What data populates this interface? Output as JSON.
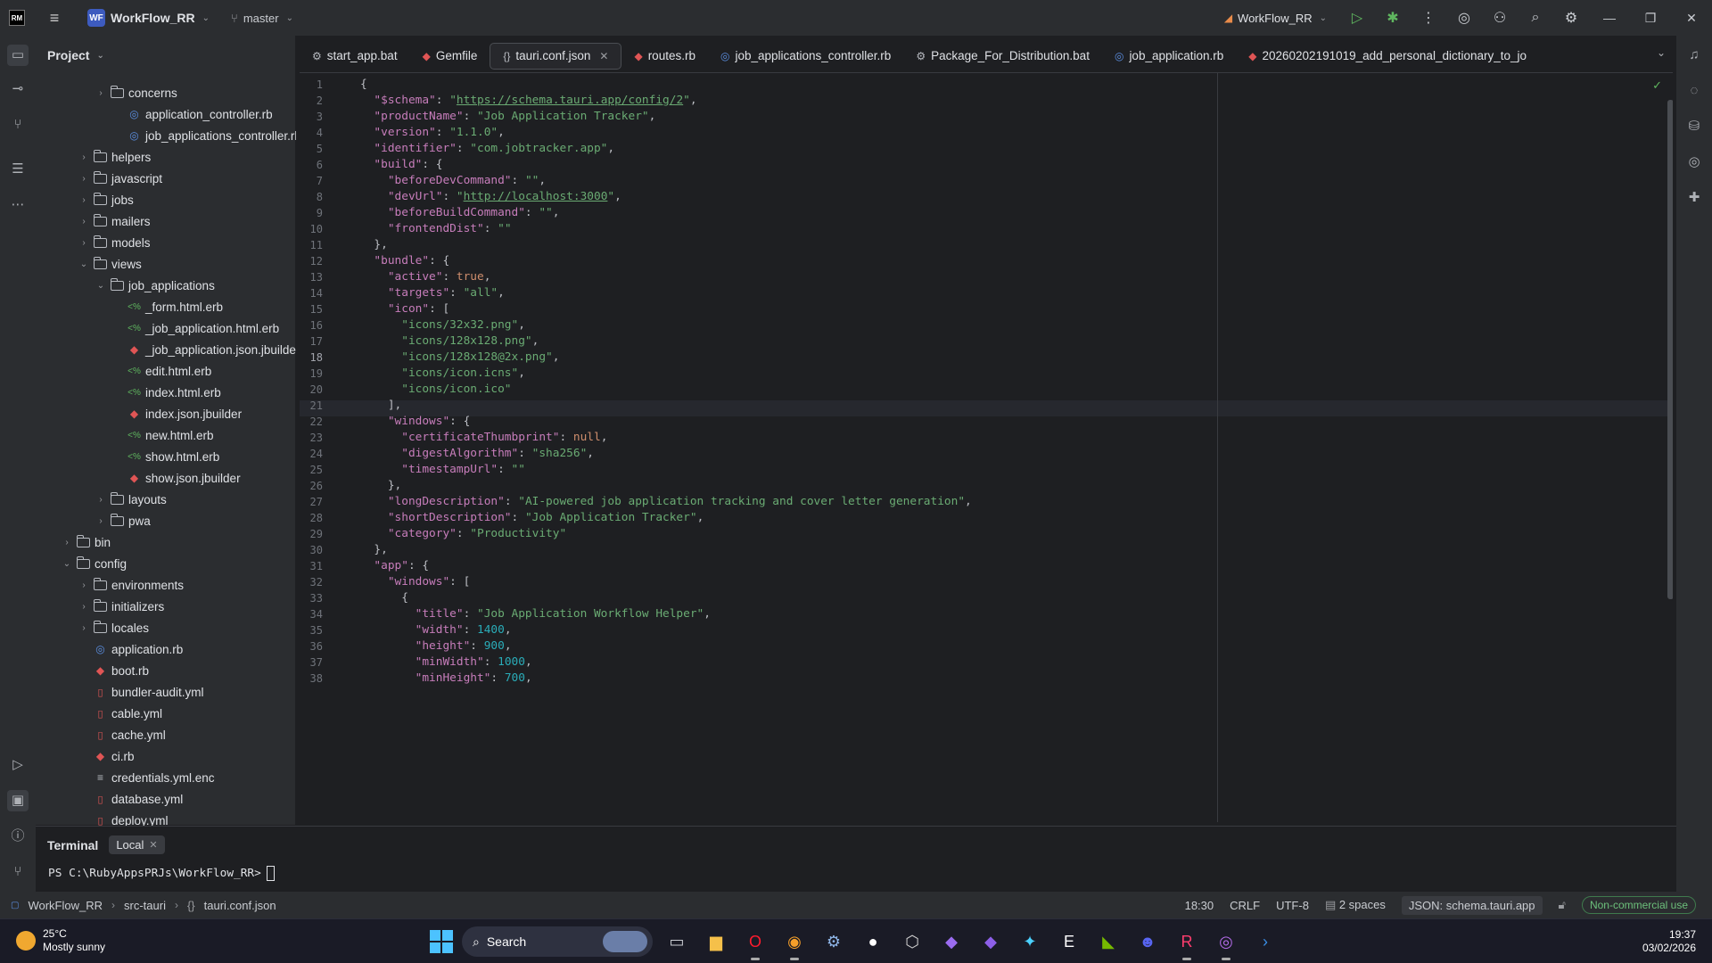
{
  "app": {
    "logo_text": "RM",
    "project_badge": "WF",
    "project_name": "WorkFlow_RR",
    "branch": "master",
    "run_config": "WorkFlow_RR",
    "accent": "#3d5bbf"
  },
  "project_panel": {
    "title": "Project",
    "tree": [
      {
        "label": "concerns",
        "type": "folder",
        "depth": 4,
        "expanded": false
      },
      {
        "label": "application_controller.rb",
        "type": "rbc",
        "depth": 5
      },
      {
        "label": "job_applications_controller.rb",
        "type": "rbc",
        "depth": 5
      },
      {
        "label": "helpers",
        "type": "folder",
        "depth": 3,
        "expanded": false
      },
      {
        "label": "javascript",
        "type": "folder",
        "depth": 3,
        "expanded": false
      },
      {
        "label": "jobs",
        "type": "folder",
        "depth": 3,
        "expanded": false
      },
      {
        "label": "mailers",
        "type": "folder",
        "depth": 3,
        "expanded": false
      },
      {
        "label": "models",
        "type": "folder",
        "depth": 3,
        "expanded": false
      },
      {
        "label": "views",
        "type": "folder",
        "depth": 3,
        "expanded": true
      },
      {
        "label": "job_applications",
        "type": "folder",
        "depth": 4,
        "expanded": true
      },
      {
        "label": "_form.html.erb",
        "type": "erb",
        "depth": 5
      },
      {
        "label": "_job_application.html.erb",
        "type": "erb",
        "depth": 5
      },
      {
        "label": "_job_application.json.jbuilder",
        "type": "ruby",
        "depth": 5
      },
      {
        "label": "edit.html.erb",
        "type": "erb",
        "depth": 5
      },
      {
        "label": "index.html.erb",
        "type": "erb",
        "depth": 5
      },
      {
        "label": "index.json.jbuilder",
        "type": "ruby",
        "depth": 5
      },
      {
        "label": "new.html.erb",
        "type": "erb",
        "depth": 5
      },
      {
        "label": "show.html.erb",
        "type": "erb",
        "depth": 5
      },
      {
        "label": "show.json.jbuilder",
        "type": "ruby",
        "depth": 5
      },
      {
        "label": "layouts",
        "type": "folder",
        "depth": 4,
        "expanded": false
      },
      {
        "label": "pwa",
        "type": "folder",
        "depth": 4,
        "expanded": false
      },
      {
        "label": "bin",
        "type": "folder",
        "depth": 2,
        "expanded": false
      },
      {
        "label": "config",
        "type": "folder",
        "depth": 2,
        "expanded": true
      },
      {
        "label": "environments",
        "type": "folder",
        "depth": 3,
        "expanded": false
      },
      {
        "label": "initializers",
        "type": "folder",
        "depth": 3,
        "expanded": false
      },
      {
        "label": "locales",
        "type": "folder",
        "depth": 3,
        "expanded": false
      },
      {
        "label": "application.rb",
        "type": "rbc",
        "depth": 3
      },
      {
        "label": "boot.rb",
        "type": "ruby",
        "depth": 3
      },
      {
        "label": "bundler-audit.yml",
        "type": "yml",
        "depth": 3
      },
      {
        "label": "cable.yml",
        "type": "yml",
        "depth": 3
      },
      {
        "label": "cache.yml",
        "type": "yml",
        "depth": 3
      },
      {
        "label": "ci.rb",
        "type": "ruby",
        "depth": 3
      },
      {
        "label": "credentials.yml.enc",
        "type": "txt",
        "depth": 3
      },
      {
        "label": "database.yml",
        "type": "yml",
        "depth": 3
      },
      {
        "label": "deploy.yml",
        "type": "yml",
        "depth": 3
      }
    ]
  },
  "tabs": [
    {
      "label": "start_app.bat",
      "icon": "bat",
      "active": false
    },
    {
      "label": "Gemfile",
      "icon": "ruby",
      "active": false
    },
    {
      "label": "tauri.conf.json",
      "icon": "json",
      "active": true
    },
    {
      "label": "routes.rb",
      "icon": "ruby",
      "active": false
    },
    {
      "label": "job_applications_controller.rb",
      "icon": "rbc",
      "active": false
    },
    {
      "label": "Package_For_Distribution.bat",
      "icon": "bat",
      "active": false
    },
    {
      "label": "job_application.rb",
      "icon": "rbc",
      "active": false
    },
    {
      "label": "20260202191019_add_personal_dictionary_to_jo",
      "icon": "ruby",
      "active": false
    }
  ],
  "editor": {
    "current_line": 18,
    "lines": [
      [
        [
          "p",
          "{"
        ]
      ],
      [
        [
          "p",
          "  "
        ],
        [
          "k",
          "\"$schema\""
        ],
        [
          "p",
          ": "
        ],
        [
          "s",
          "\""
        ],
        [
          "su",
          "https://schema.tauri.app/config/2"
        ],
        [
          "s",
          "\""
        ],
        [
          "p",
          ","
        ]
      ],
      [
        [
          "p",
          "  "
        ],
        [
          "k",
          "\"productName\""
        ],
        [
          "p",
          ": "
        ],
        [
          "s",
          "\"Job Application Tracker\""
        ],
        [
          "p",
          ","
        ]
      ],
      [
        [
          "p",
          "  "
        ],
        [
          "k",
          "\"version\""
        ],
        [
          "p",
          ": "
        ],
        [
          "s",
          "\"1.1.0\""
        ],
        [
          "p",
          ","
        ]
      ],
      [
        [
          "p",
          "  "
        ],
        [
          "k",
          "\"identifier\""
        ],
        [
          "p",
          ": "
        ],
        [
          "s",
          "\"com.jobtracker.app\""
        ],
        [
          "p",
          ","
        ]
      ],
      [
        [
          "p",
          "  "
        ],
        [
          "k",
          "\"build\""
        ],
        [
          "p",
          ": {"
        ]
      ],
      [
        [
          "p",
          "    "
        ],
        [
          "k",
          "\"beforeDevCommand\""
        ],
        [
          "p",
          ": "
        ],
        [
          "s",
          "\"\""
        ],
        [
          "p",
          ","
        ]
      ],
      [
        [
          "p",
          "    "
        ],
        [
          "k",
          "\"devUrl\""
        ],
        [
          "p",
          ": "
        ],
        [
          "s",
          "\""
        ],
        [
          "su",
          "http://localhost:3000"
        ],
        [
          "s",
          "\""
        ],
        [
          "p",
          ","
        ]
      ],
      [
        [
          "p",
          "    "
        ],
        [
          "k",
          "\"beforeBuildCommand\""
        ],
        [
          "p",
          ": "
        ],
        [
          "s",
          "\"\""
        ],
        [
          "p",
          ","
        ]
      ],
      [
        [
          "p",
          "    "
        ],
        [
          "k",
          "\"frontendDist\""
        ],
        [
          "p",
          ": "
        ],
        [
          "s",
          "\"\""
        ]
      ],
      [
        [
          "p",
          "  },"
        ]
      ],
      [
        [
          "p",
          "  "
        ],
        [
          "k",
          "\"bundle\""
        ],
        [
          "p",
          ": {"
        ]
      ],
      [
        [
          "p",
          "    "
        ],
        [
          "k",
          "\"active\""
        ],
        [
          "p",
          ": "
        ],
        [
          "kw",
          "true"
        ],
        [
          "p",
          ","
        ]
      ],
      [
        [
          "p",
          "    "
        ],
        [
          "k",
          "\"targets\""
        ],
        [
          "p",
          ": "
        ],
        [
          "s",
          "\"all\""
        ],
        [
          "p",
          ","
        ]
      ],
      [
        [
          "p",
          "    "
        ],
        [
          "k",
          "\"icon\""
        ],
        [
          "p",
          ": ["
        ]
      ],
      [
        [
          "p",
          "      "
        ],
        [
          "s",
          "\"icons/32x32.png\""
        ],
        [
          "p",
          ","
        ]
      ],
      [
        [
          "p",
          "      "
        ],
        [
          "s",
          "\"icons/128x128.png\""
        ],
        [
          "p",
          ","
        ]
      ],
      [
        [
          "p",
          "      "
        ],
        [
          "s",
          "\"icons/128x128@2x.png\""
        ],
        [
          "p",
          ","
        ]
      ],
      [
        [
          "p",
          "      "
        ],
        [
          "s",
          "\"icons/icon.icns\""
        ],
        [
          "p",
          ","
        ]
      ],
      [
        [
          "p",
          "      "
        ],
        [
          "s",
          "\"icons/icon.ico\""
        ]
      ],
      [
        [
          "p",
          "    ],"
        ]
      ],
      [
        [
          "p",
          "    "
        ],
        [
          "k",
          "\"windows\""
        ],
        [
          "p",
          ": {"
        ]
      ],
      [
        [
          "p",
          "      "
        ],
        [
          "k",
          "\"certificateThumbprint\""
        ],
        [
          "p",
          ": "
        ],
        [
          "kw",
          "null"
        ],
        [
          "p",
          ","
        ]
      ],
      [
        [
          "p",
          "      "
        ],
        [
          "k",
          "\"digestAlgorithm\""
        ],
        [
          "p",
          ": "
        ],
        [
          "s",
          "\"sha256\""
        ],
        [
          "p",
          ","
        ]
      ],
      [
        [
          "p",
          "      "
        ],
        [
          "k",
          "\"timestampUrl\""
        ],
        [
          "p",
          ": "
        ],
        [
          "s",
          "\"\""
        ]
      ],
      [
        [
          "p",
          "    },"
        ]
      ],
      [
        [
          "p",
          "    "
        ],
        [
          "k",
          "\"longDescription\""
        ],
        [
          "p",
          ": "
        ],
        [
          "s",
          "\"AI-powered job application tracking and cover letter generation\""
        ],
        [
          "p",
          ","
        ]
      ],
      [
        [
          "p",
          "    "
        ],
        [
          "k",
          "\"shortDescription\""
        ],
        [
          "p",
          ": "
        ],
        [
          "s",
          "\"Job Application Tracker\""
        ],
        [
          "p",
          ","
        ]
      ],
      [
        [
          "p",
          "    "
        ],
        [
          "k",
          "\"category\""
        ],
        [
          "p",
          ": "
        ],
        [
          "s",
          "\"Productivity\""
        ]
      ],
      [
        [
          "p",
          "  },"
        ]
      ],
      [
        [
          "p",
          "  "
        ],
        [
          "k",
          "\"app\""
        ],
        [
          "p",
          ": {"
        ]
      ],
      [
        [
          "p",
          "    "
        ],
        [
          "k",
          "\"windows\""
        ],
        [
          "p",
          ": ["
        ]
      ],
      [
        [
          "p",
          "      {"
        ]
      ],
      [
        [
          "p",
          "        "
        ],
        [
          "k",
          "\"title\""
        ],
        [
          "p",
          ": "
        ],
        [
          "s",
          "\"Job Application Workflow Helper\""
        ],
        [
          "p",
          ","
        ]
      ],
      [
        [
          "p",
          "        "
        ],
        [
          "k",
          "\"width\""
        ],
        [
          "p",
          ": "
        ],
        [
          "n",
          "1400"
        ],
        [
          "p",
          ","
        ]
      ],
      [
        [
          "p",
          "        "
        ],
        [
          "k",
          "\"height\""
        ],
        [
          "p",
          ": "
        ],
        [
          "n",
          "900"
        ],
        [
          "p",
          ","
        ]
      ],
      [
        [
          "p",
          "        "
        ],
        [
          "k",
          "\"minWidth\""
        ],
        [
          "p",
          ": "
        ],
        [
          "n",
          "1000"
        ],
        [
          "p",
          ","
        ]
      ],
      [
        [
          "p",
          "        "
        ],
        [
          "k",
          "\"minHeight\""
        ],
        [
          "p",
          ": "
        ],
        [
          "n",
          "700"
        ],
        [
          "p",
          ","
        ]
      ]
    ]
  },
  "terminal": {
    "title": "Terminal",
    "tab": "Local",
    "prompt": "PS C:\\RubyAppsPRJs\\WorkFlow_RR>"
  },
  "status": {
    "breadcrumb": [
      "WorkFlow_RR",
      "src-tauri",
      "tauri.conf.json"
    ],
    "position": "18:30",
    "line_ending": "CRLF",
    "encoding": "UTF-8",
    "indent": "2 spaces",
    "schema": "JSON: schema.tauri.app",
    "license": "Non-commercial use"
  },
  "taskbar": {
    "temperature": "25°C",
    "weather": "Mostly sunny",
    "search_label": "Search",
    "time": "19:37",
    "date": "03/02/2026",
    "apps": [
      {
        "name": "task-view",
        "glyph": "▭",
        "color": "#c9ccd1"
      },
      {
        "name": "file-explorer",
        "glyph": "▆",
        "color": "#f5c04a"
      },
      {
        "name": "opera",
        "glyph": "O",
        "color": "#ff1b2d"
      },
      {
        "name": "app-orange",
        "glyph": "◉",
        "color": "#f59f2a"
      },
      {
        "name": "steam",
        "glyph": "⚙",
        "color": "#8fb6e8"
      },
      {
        "name": "github",
        "glyph": "●",
        "color": "#ffffff"
      },
      {
        "name": "unity",
        "glyph": "⬡",
        "color": "#d0d0d0"
      },
      {
        "name": "visual-studio-preview",
        "glyph": "◆",
        "color": "#9b6cf0"
      },
      {
        "name": "visual-studio",
        "glyph": "◆",
        "color": "#8d5fe8"
      },
      {
        "name": "cursor-app",
        "glyph": "✦",
        "color": "#4bd1ff"
      },
      {
        "name": "epic-games",
        "glyph": "E",
        "color": "#ffffff"
      },
      {
        "name": "nvidia",
        "glyph": "◣",
        "color": "#76b900"
      },
      {
        "name": "discord",
        "glyph": "☻",
        "color": "#5865f2"
      },
      {
        "name": "rubymine",
        "glyph": "R",
        "color": "#ff3d6e"
      },
      {
        "name": "app-purple",
        "glyph": "◎",
        "color": "#b36be8"
      },
      {
        "name": "powershell",
        "glyph": "›",
        "color": "#3a8ee6"
      }
    ]
  }
}
